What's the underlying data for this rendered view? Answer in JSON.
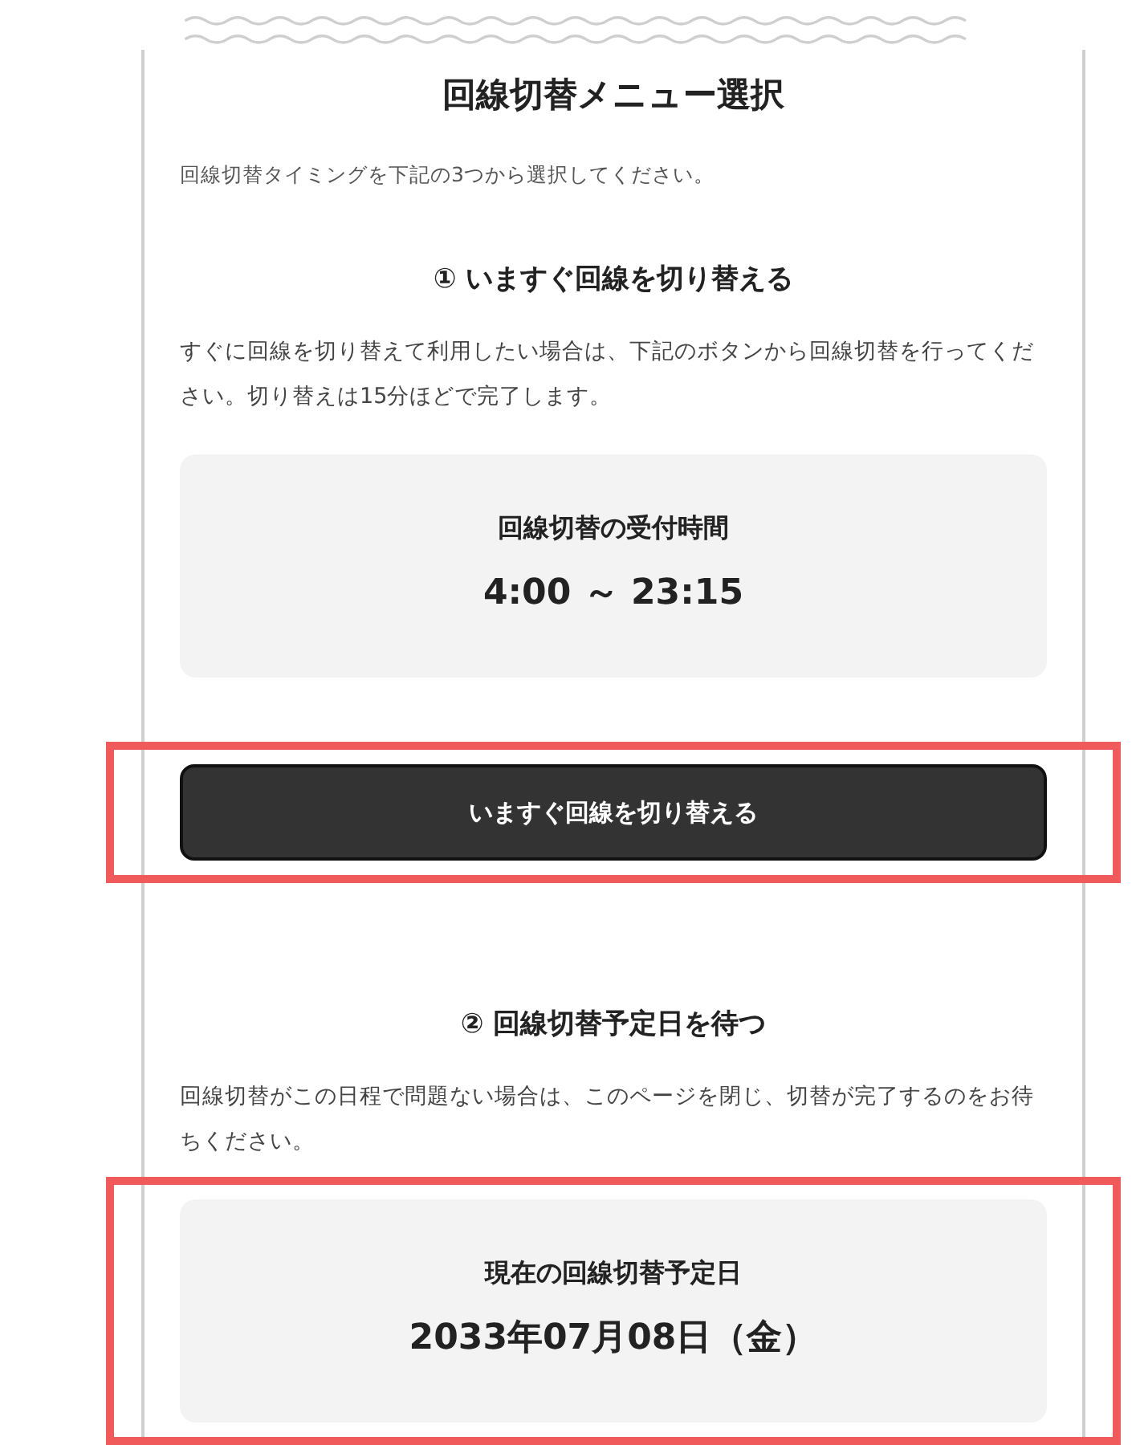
{
  "title": "回線切替メニュー選択",
  "intro": "回線切替タイミングを下記の3つから選択してください。",
  "sections": [
    {
      "heading": "① いますぐ回線を切り替える",
      "description": "すぐに回線を切り替えて利用したい場合は、下記のボタンから回線切替を行ってください。切り替えは15分ほどで完了します。",
      "info_card": {
        "label": "回線切替の受付時間",
        "value": "4:00 ～ 23:15",
        "highlighted": false
      },
      "button": {
        "label": "いますぐ回線を切り替える",
        "highlighted": true
      }
    },
    {
      "heading": "② 回線切替予定日を待つ",
      "description": "回線切替がこの日程で問題ない場合は、このページを閉じ、切替が完了するのをお待ちください。",
      "info_card": {
        "label": "現在の回線切替予定日",
        "value": "2033年07月08日（金）",
        "highlighted": true
      }
    }
  ]
}
